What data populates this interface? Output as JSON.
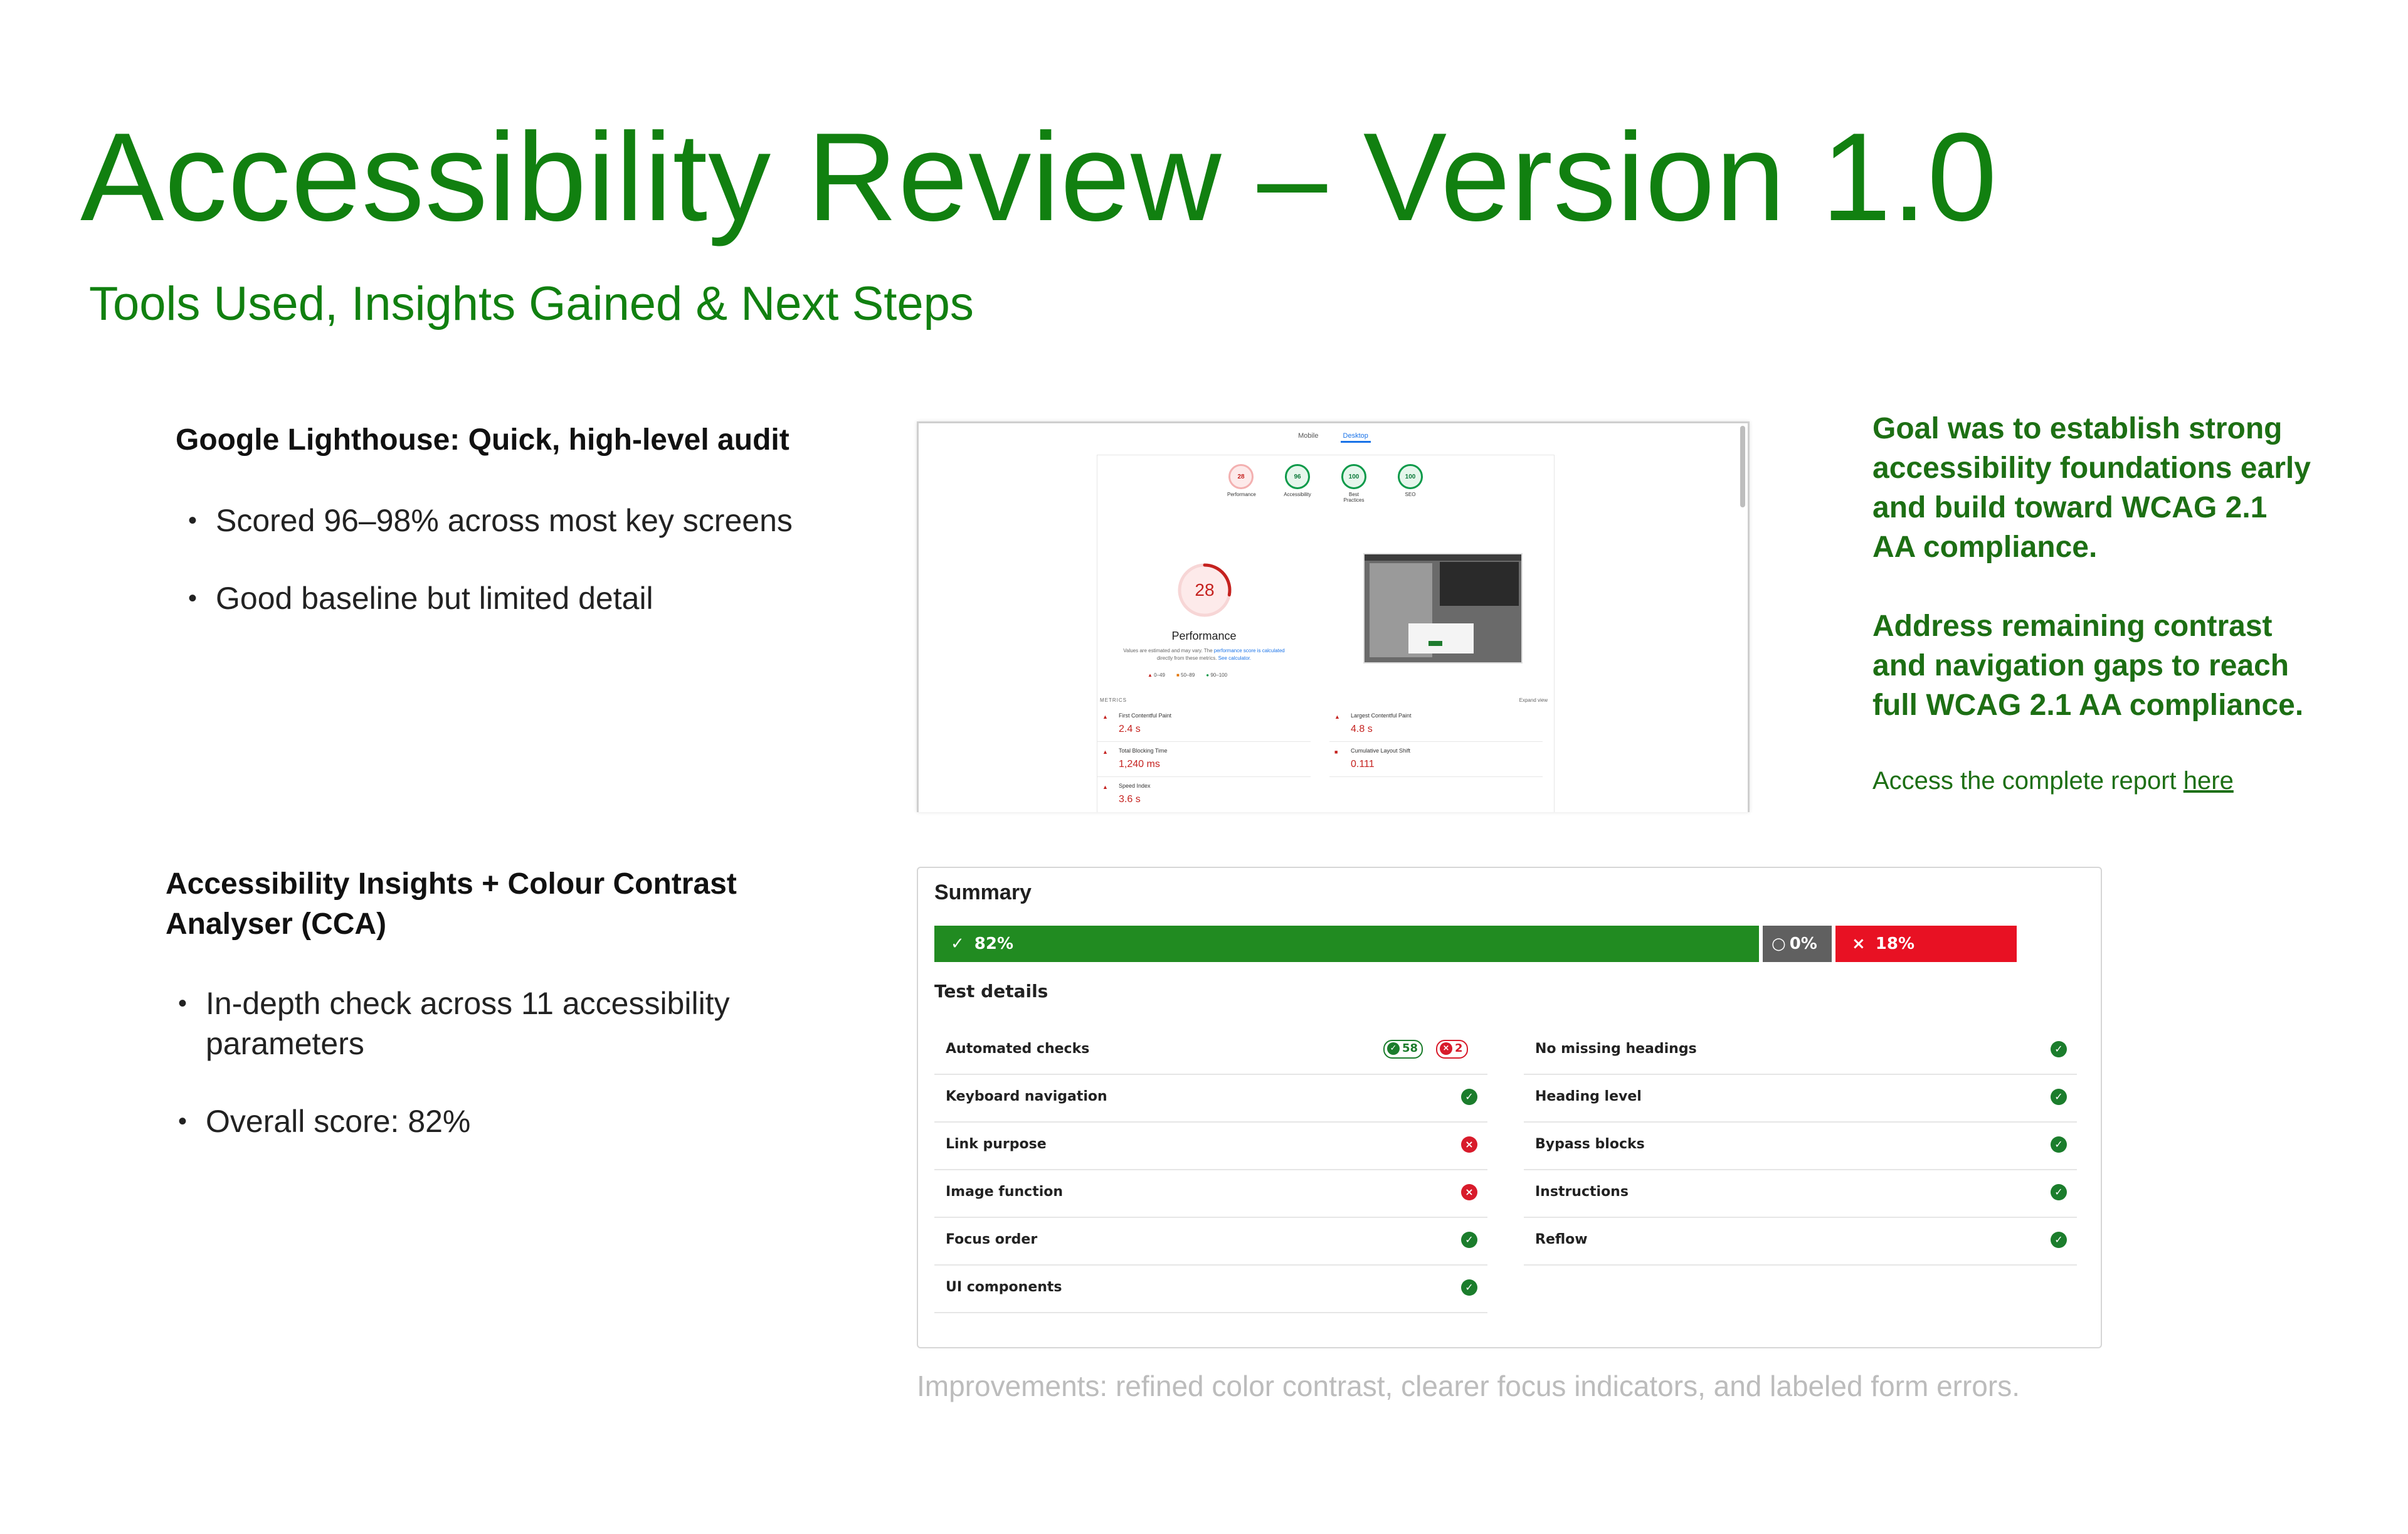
{
  "title": "Accessibility Review – Version 1.0",
  "subtitle": "Tools Used, Insights Gained & Next Steps",
  "lighthouse": {
    "heading": "Google Lighthouse: Quick, high-level audit",
    "bullets": [
      "Scored 96–98% across most key screens",
      "Good baseline but limited detail"
    ]
  },
  "lighthouse_shot": {
    "tabs": [
      "Mobile",
      "Desktop"
    ],
    "gauges": [
      {
        "score": "28",
        "label": "Performance",
        "status": "red"
      },
      {
        "score": "96",
        "label": "Accessibility",
        "status": "green"
      },
      {
        "score": "100",
        "label": "Best Practices",
        "status": "green"
      },
      {
        "score": "100",
        "label": "SEO",
        "status": "green"
      }
    ],
    "big_score": "28",
    "big_score_fraction": 0.28,
    "perf_label": "Performance",
    "perf_note_a": "Values are estimated and may vary. The",
    "perf_note_link": "performance score is calculated",
    "perf_note_b": "directly from these metrics.",
    "perf_note_link2": "See calculator.",
    "legend": [
      "0–49",
      "50–89",
      "90–100"
    ],
    "metrics_label": "METRICS",
    "expand": "Expand view",
    "metrics": [
      {
        "name": "First Contentful Paint",
        "value": "2.4 s",
        "marker": "▲"
      },
      {
        "name": "Largest Contentful Paint",
        "value": "4.8 s",
        "marker": "▲"
      },
      {
        "name": "Total Blocking Time",
        "value": "1,240 ms",
        "marker": "▲"
      },
      {
        "name": "Cumulative Layout Shift",
        "value": "0.111",
        "marker": "■"
      },
      {
        "name": "Speed Index",
        "value": "3.6 s",
        "marker": "▲"
      }
    ]
  },
  "goal": {
    "p1": "Goal was to establish strong accessibility foundations early and build toward WCAG 2.1 AA compliance.",
    "p2": "Address remaining contrast and navigation gaps to reach full WCAG 2.1 AA compliance.",
    "access_text": "Access the complete report ",
    "access_link": "here"
  },
  "insights": {
    "heading": "Accessibility Insights + Colour Contrast Analyser (CCA)",
    "bullets": [
      "In-depth check across 11 accessibility parameters",
      "Overall score: 82%"
    ]
  },
  "summary": {
    "title": "Summary",
    "bars": [
      {
        "label": "82%",
        "icon": "check-icon",
        "fraction": 0.82,
        "color": "#218b21"
      },
      {
        "label": "0%",
        "icon": "circle-icon",
        "fraction": 0.0,
        "color": "#606060"
      },
      {
        "label": "18%",
        "icon": "cross-icon",
        "fraction": 0.18,
        "color": "#e81123"
      }
    ],
    "details_heading": "Test details",
    "left_rows": [
      {
        "label": "Automated checks",
        "status": "mixed",
        "pass_count": "58",
        "fail_count": "2"
      },
      {
        "label": "Keyboard navigation",
        "status": "pass"
      },
      {
        "label": "Link purpose",
        "status": "fail"
      },
      {
        "label": "Image function",
        "status": "fail"
      },
      {
        "label": "Focus order",
        "status": "pass"
      },
      {
        "label": "UI components",
        "status": "pass"
      }
    ],
    "right_rows": [
      {
        "label": "No missing headings",
        "status": "pass"
      },
      {
        "label": "Heading level",
        "status": "pass"
      },
      {
        "label": "Bypass blocks",
        "status": "pass"
      },
      {
        "label": "Instructions",
        "status": "pass"
      },
      {
        "label": "Reflow",
        "status": "pass"
      }
    ]
  },
  "improvements": "Improvements: refined color contrast, clearer focus indicators, and labeled form errors.",
  "colors": {
    "brand_green": "#118010",
    "pass": "#1b7d2c",
    "fail": "#d81b2b"
  }
}
